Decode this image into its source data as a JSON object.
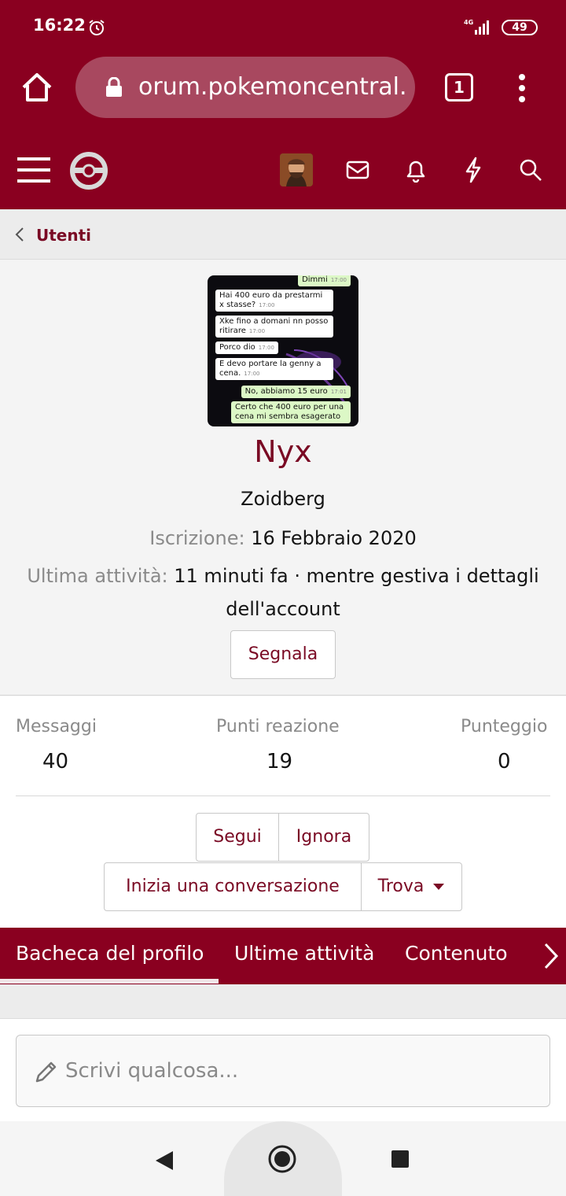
{
  "status_bar": {
    "time": "16:22",
    "network": "4G",
    "battery": "49"
  },
  "browser": {
    "url": "orum.pokemoncentral.it",
    "tab_count": "1"
  },
  "breadcrumb": {
    "label": "Utenti"
  },
  "profile": {
    "username": "Nyx",
    "user_title": "Zoidberg",
    "joined_label": "Iscrizione:",
    "joined_value": "16 Febbraio 2020",
    "last_activity_label": "Ultima attività:",
    "last_activity_value": "11 minuti fa · mentre gestiva i dettagli dell'account",
    "report_button": "Segnala",
    "avatar_chat": [
      {
        "text": "Dimmi",
        "time": "17:00",
        "dir": "out"
      },
      {
        "text": "Hai 400 euro da prestarmi x stasse?",
        "time": "17:00",
        "dir": "in"
      },
      {
        "text": "Xke fino a domani nn posso ritirare",
        "time": "17:00",
        "dir": "in"
      },
      {
        "text": "Porco dio",
        "time": "17:00",
        "dir": "in"
      },
      {
        "text": "E devo portare la genny a cena.",
        "time": "17:00",
        "dir": "in"
      },
      {
        "text": "No, abbiamo 15 euro",
        "time": "17:01",
        "dir": "out"
      },
      {
        "text": "Certo che 400 euro per una cena mi sembra esagerato",
        "time": "",
        "dir": "out"
      }
    ]
  },
  "stats": {
    "messages_label": "Messaggi",
    "messages_value": "40",
    "reactions_label": "Punti reazione",
    "reactions_value": "19",
    "score_label": "Punteggio",
    "score_value": "0"
  },
  "actions": {
    "follow": "Segui",
    "ignore": "Ignora",
    "start_conversation": "Inizia una conversazione",
    "find": "Trova"
  },
  "tabs": [
    {
      "label": "Bacheca del profilo",
      "active": true
    },
    {
      "label": "Ultime attività",
      "active": false
    },
    {
      "label": "Contenuto",
      "active": false
    }
  ],
  "composer": {
    "placeholder": "Scrivi qualcosa..."
  },
  "colors": {
    "brand": "#8a0020",
    "link": "#7a0a24",
    "muted": "#8a8a8a"
  }
}
